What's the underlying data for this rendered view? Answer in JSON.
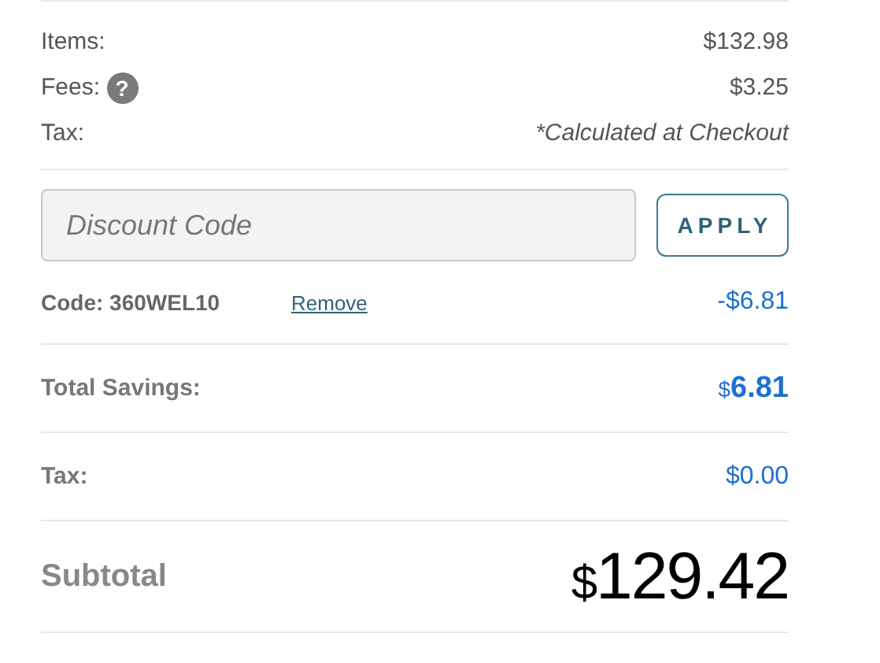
{
  "summary": [
    {
      "label": "Items:",
      "value": "$132.98",
      "kind": "plain"
    },
    {
      "label": "Fees:",
      "help": "?",
      "value": "$3.25",
      "kind": "plain"
    },
    {
      "label": "Tax:",
      "value": "*Calculated at Checkout",
      "kind": "note"
    }
  ],
  "discount": {
    "placeholder": "Discount Code",
    "button": "APPLY"
  },
  "code": {
    "label": "Code: 360WEL10",
    "link": "Remove",
    "amount": "-$6.81"
  },
  "savings": {
    "label": "Total Savings:",
    "currency": "$",
    "amount": "6.81"
  },
  "tax": {
    "label": "Tax:",
    "amount": "$0.00"
  },
  "subtotal": {
    "label": "Subtotal",
    "currency": "$",
    "amount": "129.42"
  }
}
